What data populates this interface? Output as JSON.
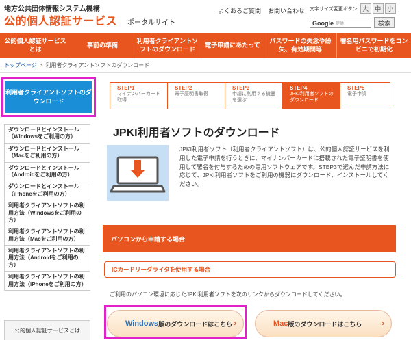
{
  "header": {
    "org": "地方公共団体情報システム機構",
    "brand": "公的個人認証サービス",
    "portal": "ポータルサイト",
    "links": [
      "よくあるご質問",
      "お問い合わせ"
    ],
    "fontsize_label": "文字サイズ変更ボタン",
    "fontsize_buttons": [
      "大",
      "中",
      "小"
    ],
    "search_brand": "Google",
    "search_hint": "提供",
    "search_button": "検索"
  },
  "nav": {
    "items": [
      "公的個人認証サービスとは",
      "事前の準備",
      "利用者クライアントソフトのダウンロード",
      "電子申請にあたって",
      "パスワードの失念や紛失、有効期間等",
      "署名用パスワードをコンビニで初期化"
    ]
  },
  "breadcrumb": {
    "home": "トップページ",
    "separator": ">",
    "current": "利用者クライアントソフトのダウンロード"
  },
  "sidebar": {
    "active": "利用者クライアントソフトのダウンロード",
    "items": [
      "ダウンロードとインストール（Windowsをご利用の方）",
      "ダウンロードとインストール（Macをご利用の方）",
      "ダウンロードとインストール（Androidをご利用の方）",
      "ダウンロードとインストール（iPhoneをご利用の方）",
      "利用者クライアントソフトの利用方法（Windowsをご利用の方）",
      "利用者クライアントソフトの利用方法（Macをご利用の方）",
      "利用者クライアントソフトの利用方法（Androidをご利用の方）",
      "利用者クライアントソフトの利用方法（iPhoneをご利用の方）"
    ],
    "bottom": "公的個人認証サービスとは"
  },
  "steps": [
    {
      "num": "STEP1",
      "text": "マイナンバーカード取得"
    },
    {
      "num": "STEP2",
      "text": "電子証明書取得"
    },
    {
      "num": "STEP3",
      "text": "申請に利用する機器を選ぶ"
    },
    {
      "num": "STEP4",
      "text": "JPKI利用者ソフトのダウンロード"
    },
    {
      "num": "STEP5",
      "text": "電子申請"
    }
  ],
  "main": {
    "title": "JPKI利用者ソフトのダウンロード",
    "intro": "JPKI利用者ソフト（利用者クライアントソフト）は、公的個人認証サービスを利用した電子申請を行うときに、マイナンバーカードに搭載された電子証明書を使用して署名を付与するための専用ソフトウェアです。STEP3で選んだ申請方法に応じて、JPKI利用者ソフトをご利用の機器にダウンロード、インストールしてください。",
    "panel": "パソコンから申請する場合",
    "subpanel": "ICカードリーダライタを使用する場合",
    "guide": "ご利用のパソコン環境に応じたJPKI利用者ソフトを次のリンクからダウンロードしてください。",
    "win_os": "Windows",
    "win_rest": "版のダウンロードはこちら",
    "mac_os": "Mac",
    "mac_rest": "版のダウンロードはこちら",
    "arrow": "›"
  },
  "colors": {
    "accent": "#e8551e",
    "sidebar_active": "#1a8fd8",
    "highlight": "#e020c8",
    "monitor_bg": "#c7dff5",
    "win_text": "#2a6fb8",
    "mac_text": "#e8551e"
  }
}
